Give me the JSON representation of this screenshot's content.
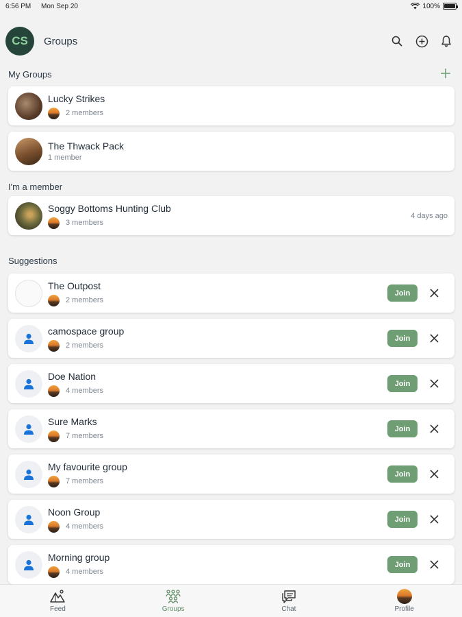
{
  "status": {
    "time": "6:56 PM",
    "date": "Mon Sep 20",
    "battery": "100%",
    "battery_level": 1.0
  },
  "header": {
    "logo_text": "CS",
    "title": "Groups"
  },
  "sections": {
    "my_groups": "My Groups",
    "member": "I'm a member",
    "suggestions": "Suggestions"
  },
  "my_groups": [
    {
      "name": "Lucky Strikes",
      "members": "2 members"
    },
    {
      "name": "The Thwack Pack",
      "members": "1 member"
    }
  ],
  "member_groups": [
    {
      "name": "Soggy Bottoms Hunting Club",
      "members": "3 members",
      "time": "4 days ago"
    }
  ],
  "suggestions": [
    {
      "name": "The Outpost",
      "members": "2 members"
    },
    {
      "name": "camospace group",
      "members": "2 members"
    },
    {
      "name": "Doe Nation",
      "members": "4 members"
    },
    {
      "name": "Sure Marks",
      "members": "7 members"
    },
    {
      "name": "My favourite group",
      "members": "7 members"
    },
    {
      "name": "Noon Group",
      "members": "4 members"
    },
    {
      "name": "Morning group",
      "members": "4 members"
    }
  ],
  "join_label": "Join",
  "tabs": [
    {
      "label": "Feed",
      "icon": "feed-icon"
    },
    {
      "label": "Groups",
      "icon": "groups-icon"
    },
    {
      "label": "Chat",
      "icon": "chat-icon"
    },
    {
      "label": "Profile",
      "icon": "profile-avatar"
    }
  ],
  "colors": {
    "accent": "#6f9e74",
    "logo_bg": "#25443a",
    "person_icon": "#1a73d9"
  }
}
